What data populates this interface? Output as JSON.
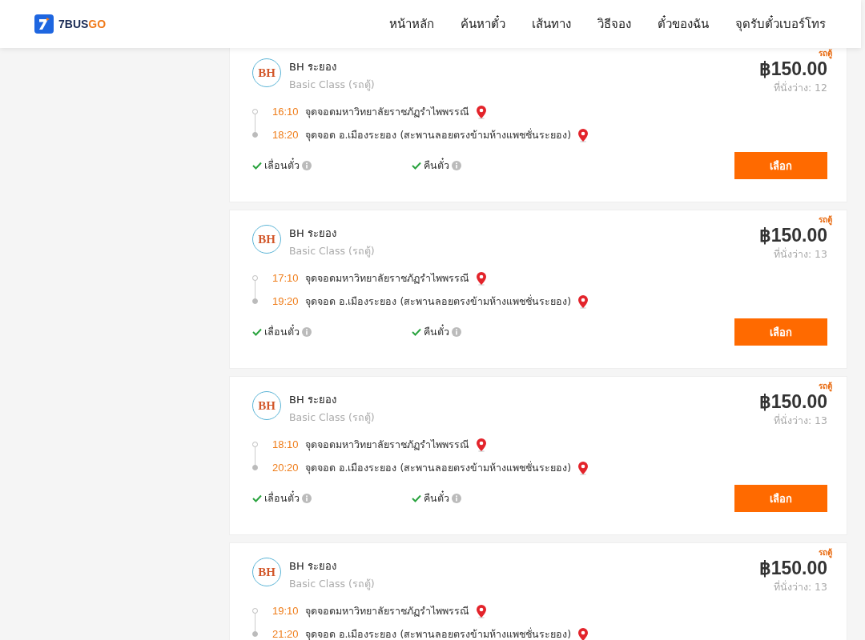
{
  "brand": {
    "prefix": "7BUS",
    "suffix": "GO"
  },
  "nav": [
    "หน้าหลัก",
    "ค้นหาตั๋ว",
    "เส้นทาง",
    "วิธีจอง",
    "ตั๋วของฉัน",
    "จุดรับตั๋วเบอร์โทร"
  ],
  "trips": [
    {
      "tag": "รถตู้",
      "operator": "BH ระยอง",
      "logo": "BH",
      "vehicle_class": "Basic Class (รถตู้)",
      "price": "฿150.00",
      "seats": "ที่นั่งว่าง: 12",
      "stops": [
        {
          "time": "16:10",
          "place": "จุดจอดมหาวิทยาลัยราชภัฏรำไพพรรณี"
        },
        {
          "time": "18:20",
          "place": "จุดจอด อ.เมืองระยอง (สะพานลอยตรงข้ามห้างแพชชั่นระยอง)"
        }
      ],
      "features": [
        "เลื่อนตั๋ว",
        "คืนตั๋ว"
      ],
      "button": "เลือก"
    },
    {
      "tag": "รถตู้",
      "operator": "BH ระยอง",
      "logo": "BH",
      "vehicle_class": "Basic Class (รถตู้)",
      "price": "฿150.00",
      "seats": "ที่นั่งว่าง: 13",
      "stops": [
        {
          "time": "17:10",
          "place": "จุดจอดมหาวิทยาลัยราชภัฏรำไพพรรณี"
        },
        {
          "time": "19:20",
          "place": "จุดจอด อ.เมืองระยอง (สะพานลอยตรงข้ามห้างแพชชั่นระยอง)"
        }
      ],
      "features": [
        "เลื่อนตั๋ว",
        "คืนตั๋ว"
      ],
      "button": "เลือก"
    },
    {
      "tag": "รถตู้",
      "operator": "BH ระยอง",
      "logo": "BH",
      "vehicle_class": "Basic Class (รถตู้)",
      "price": "฿150.00",
      "seats": "ที่นั่งว่าง: 13",
      "stops": [
        {
          "time": "18:10",
          "place": "จุดจอดมหาวิทยาลัยราชภัฏรำไพพรรณี"
        },
        {
          "time": "20:20",
          "place": "จุดจอด อ.เมืองระยอง (สะพานลอยตรงข้ามห้างแพชชั่นระยอง)"
        }
      ],
      "features": [
        "เลื่อนตั๋ว",
        "คืนตั๋ว"
      ],
      "button": "เลือก"
    },
    {
      "tag": "รถตู้",
      "operator": "BH ระยอง",
      "logo": "BH",
      "vehicle_class": "Basic Class (รถตู้)",
      "price": "฿150.00",
      "seats": "ที่นั่งว่าง: 13",
      "stops": [
        {
          "time": "19:10",
          "place": "จุดจอดมหาวิทยาลัยราชภัฏรำไพพรรณี"
        },
        {
          "time": "21:20",
          "place": "จุดจอด อ.เมืองระยอง (สะพานลอยตรงข้ามห้างแพชชั่นระยอง)"
        }
      ]
    }
  ]
}
